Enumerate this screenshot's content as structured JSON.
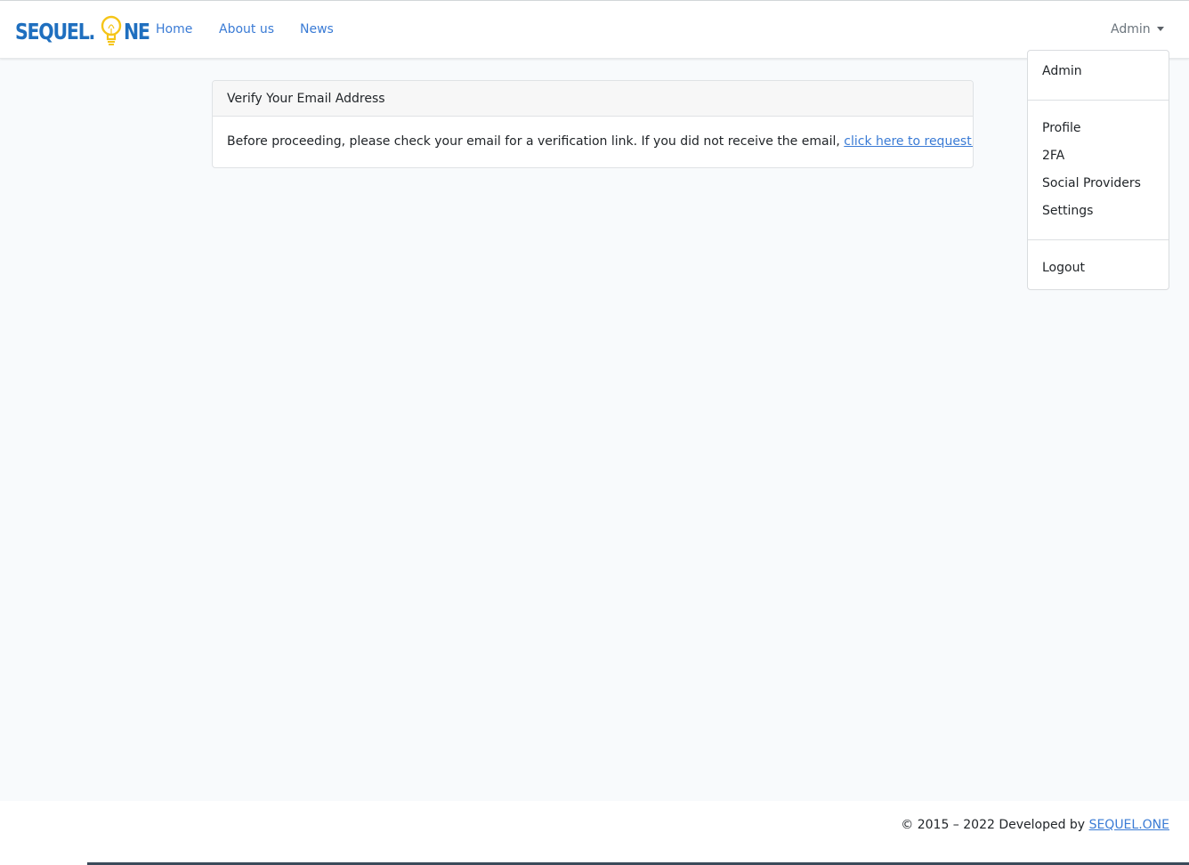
{
  "brand": {
    "name_left": "SEQUEL.",
    "name_right": "NE",
    "colors": {
      "blue": "#1f6fbf",
      "bulb": "#f5c518"
    }
  },
  "nav": {
    "links": [
      "Home",
      "About us",
      "News"
    ],
    "user_label": "Admin"
  },
  "dropdown": {
    "header": "Admin",
    "items": [
      "Profile",
      "2FA",
      "Social Providers",
      "Settings"
    ],
    "logout": "Logout"
  },
  "card": {
    "title": "Verify Your Email Address",
    "body_text": "Before proceeding, please check your email for a verification link. If you did not receive the email,",
    "link_text": "click here to request another",
    "body_suffix": "."
  },
  "footer": {
    "text": "© 2015 – 2022 Developed by",
    "link_text": "SEQUEL.ONE"
  },
  "theme": {
    "link_color": "#3a7bd5",
    "background": "#f8fafc"
  }
}
